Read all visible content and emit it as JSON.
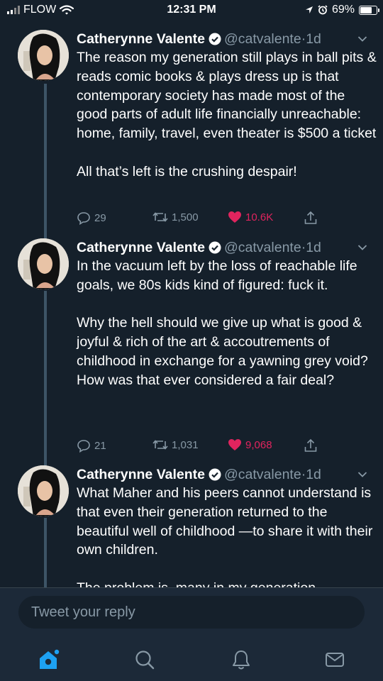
{
  "status_bar": {
    "carrier": "FLOW",
    "time": "12:31 PM",
    "battery": "69%"
  },
  "tweets": [
    {
      "name": "Catherynne Valente",
      "handle": "@catvalente",
      "dot": "·",
      "time": "1d",
      "paragraphs": [
        "The reason my generation still plays in ball pits & reads comic books & plays dress up is that contemporary society has made most of the good parts of adult life financially unreachable: home, family, travel, even theater is $500 a ticket",
        "All that’s left is the crushing despair!"
      ],
      "replies": "29",
      "retweets": "1,500",
      "likes": "10.6K"
    },
    {
      "name": "Catherynne Valente",
      "handle": "@catvalente",
      "dot": "·",
      "time": "1d",
      "paragraphs": [
        "In the vacuum left by the loss of reachable life goals, we 80s kids kind of figured: fuck it.",
        "Why the hell should we give up what is good & joyful & rich of the art & accoutrements of childhood in exchange for a yawning grey void? How was that ever considered a fair deal?"
      ],
      "replies": "21",
      "retweets": "1,031",
      "likes": "9,068"
    },
    {
      "name": "Catherynne Valente",
      "handle": "@catvalente",
      "dot": "·",
      "time": "1d",
      "paragraphs": [
        "What Maher and his peers cannot understand is that even their generation returned to the beautiful well of childhood —to share it with their own children.",
        "The problem is, many in my generation"
      ]
    }
  ],
  "reply": {
    "placeholder": "Tweet your reply"
  },
  "tabs": [
    "home-icon",
    "search-icon",
    "notifications-icon",
    "messages-icon"
  ],
  "colors": {
    "background": "#15202b",
    "like": "#e0245e",
    "accent": "#1da1f2",
    "secondary_text": "#8899a6"
  }
}
